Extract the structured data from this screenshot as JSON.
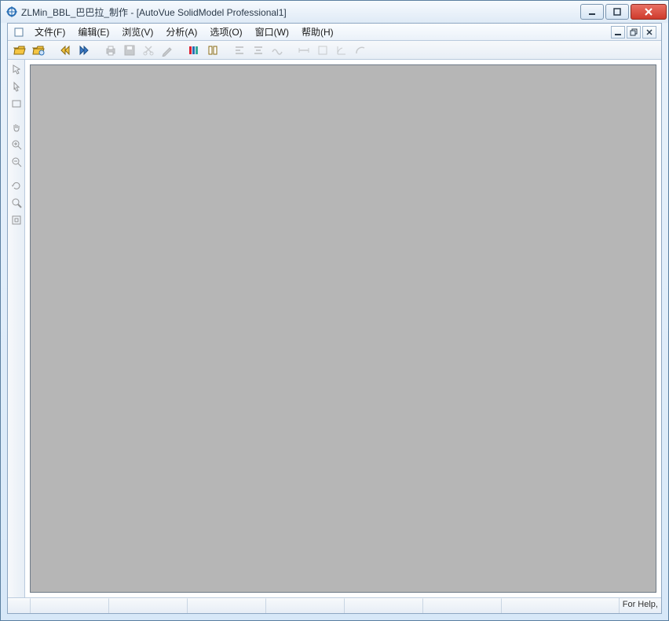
{
  "title": "ZLMin_BBL_巴巴拉_制作 - [AutoVue SolidModel Professional1]",
  "menu": {
    "file": "文件(F)",
    "edit": "编辑(E)",
    "view": "浏览(V)",
    "analyze": "分析(A)",
    "options": "选项(O)",
    "window": "窗口(W)",
    "help": "帮助(H)"
  },
  "status": {
    "help": "For Help,"
  }
}
